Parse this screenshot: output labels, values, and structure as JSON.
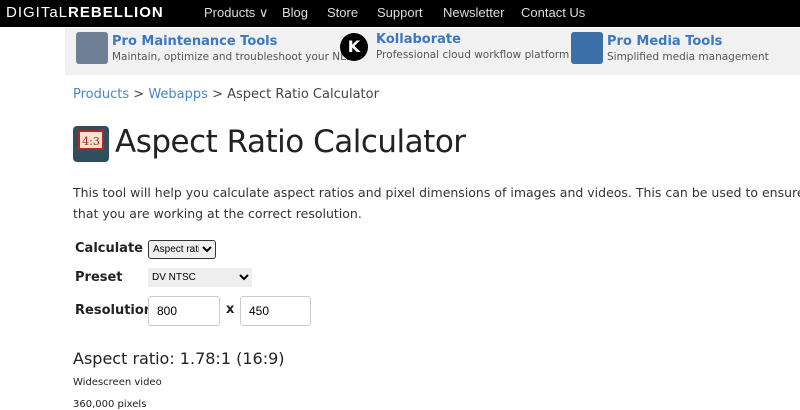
{
  "nav": {
    "logo_light": "DIGITaL",
    "logo_bold": "REBELLION",
    "items": [
      "Products ∨",
      "Blog",
      "Store",
      "Support",
      "Newsletter",
      "Contact Us"
    ]
  },
  "promos": [
    {
      "title": "Pro Maintenance Tools",
      "subtitle": "Maintain, optimize and troubleshoot your NLE"
    },
    {
      "title": "Kollaborate",
      "subtitle": "Professional cloud workflow platform",
      "icon_letter": "K"
    },
    {
      "title": "Pro Media Tools",
      "subtitle": "Simplified media management"
    }
  ],
  "breadcrumb": {
    "items": [
      "Products",
      "Webapps"
    ],
    "current": "Aspect Ratio Calculator",
    "sep": ">"
  },
  "page": {
    "icon_text": "4:3",
    "title": "Aspect Ratio Calculator",
    "description": "This tool will help you calculate aspect ratios and pixel dimensions of images and videos. This can be used to ensure that you are working at the correct resolution."
  },
  "form": {
    "calculate_label": "Calculate",
    "calculate_value": "Aspect ratio",
    "preset_label": "Preset",
    "preset_value": "DV NTSC",
    "resolution_label": "Resolution",
    "width": "800",
    "height": "450",
    "x": "x"
  },
  "result": {
    "ratio": "Aspect ratio: 1.78:1 (16:9)",
    "type": "Widescreen video",
    "pixels": "360,000 pixels"
  }
}
